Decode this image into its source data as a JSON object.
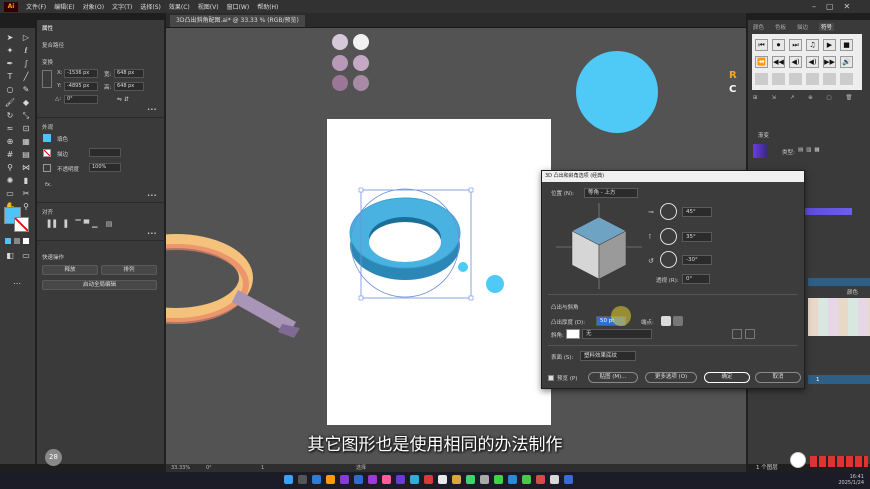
{
  "app": {
    "logo": "Ai"
  },
  "menu": [
    "文件(F)",
    "编辑(E)",
    "对象(O)",
    "文字(T)",
    "选择(S)",
    "效果(C)",
    "视图(V)",
    "窗口(W)",
    "帮助(H)"
  ],
  "doc_tab": "3D凸出斜角配图.ai* @ 33.33 % (RGB/预览)",
  "props": {
    "tab": "属性",
    "section_label": "复合路径",
    "transform": "变换",
    "x_label": "X:",
    "x": "-1536 px",
    "y_label": "Y:",
    "y": "-4895 px",
    "w_label": "宽:",
    "w": "648 px",
    "h_label": "高:",
    "h": "648 px",
    "angle_label": "△:",
    "angle": "0°",
    "appearance": "外观",
    "fill": "填色",
    "stroke": "描边",
    "opacity_label": "不透明度",
    "opacity": "100%",
    "fx": "fx.",
    "align": "对齐",
    "quick_actions": "快速操作",
    "btn_release": "释放",
    "btn_arrange": "排列",
    "btn_global_edit": "启动全局编辑"
  },
  "right": {
    "tabs": [
      "颜色",
      "色板",
      "描边",
      "符号"
    ],
    "glyphs": [
      "⏮",
      "⏺",
      "⏭",
      "♫",
      "▶",
      "■",
      "⏪",
      "◀◀",
      "◀)",
      "◀)",
      "▶▶",
      "🔊"
    ],
    "gradient_tab": "渐变",
    "type_label": "类型:",
    "layer_label": "1",
    "layers_count": "1 个图层",
    "swatch_label": "颜色"
  },
  "dialog": {
    "title": "3D 凸出和斜角选项 (经典)",
    "position_label": "位置 (N):",
    "position_value": "等角 - 上方",
    "rot_x": "45°",
    "rot_y": "35°",
    "rot_z": "-30°",
    "persp_label": "透视 (R):",
    "persp": "0°",
    "extrude_section": "凸出与斜角",
    "extrude_depth_label": "凸出厚度 (D):",
    "extrude_depth": "50 pt",
    "cap_label": "端点:",
    "bevel_label": "斜角:",
    "bevel_value": "无",
    "surface_label": "表面 (S):",
    "surface_value": "塑料效果底纹",
    "preview_label": "预览 (P)",
    "btn_map": "贴图 (M)...",
    "btn_more": "更多选项 (O)",
    "btn_ok": "确定",
    "btn_cancel": "取消"
  },
  "subtitle": "其它图形也是使用相同的办法制作",
  "status": {
    "zoom": "33.33%",
    "angle": "0°",
    "page": "1",
    "tool": "选择"
  },
  "taskbar": {
    "date": "2025/1/24",
    "time": "16:41"
  },
  "avatar_number": "28",
  "colors": {
    "accent_blue": "#4fc3f7",
    "torus": "#3fa9d9",
    "dot_blue": "#4fc9f5",
    "gradient_purple": "#6a3de0"
  }
}
